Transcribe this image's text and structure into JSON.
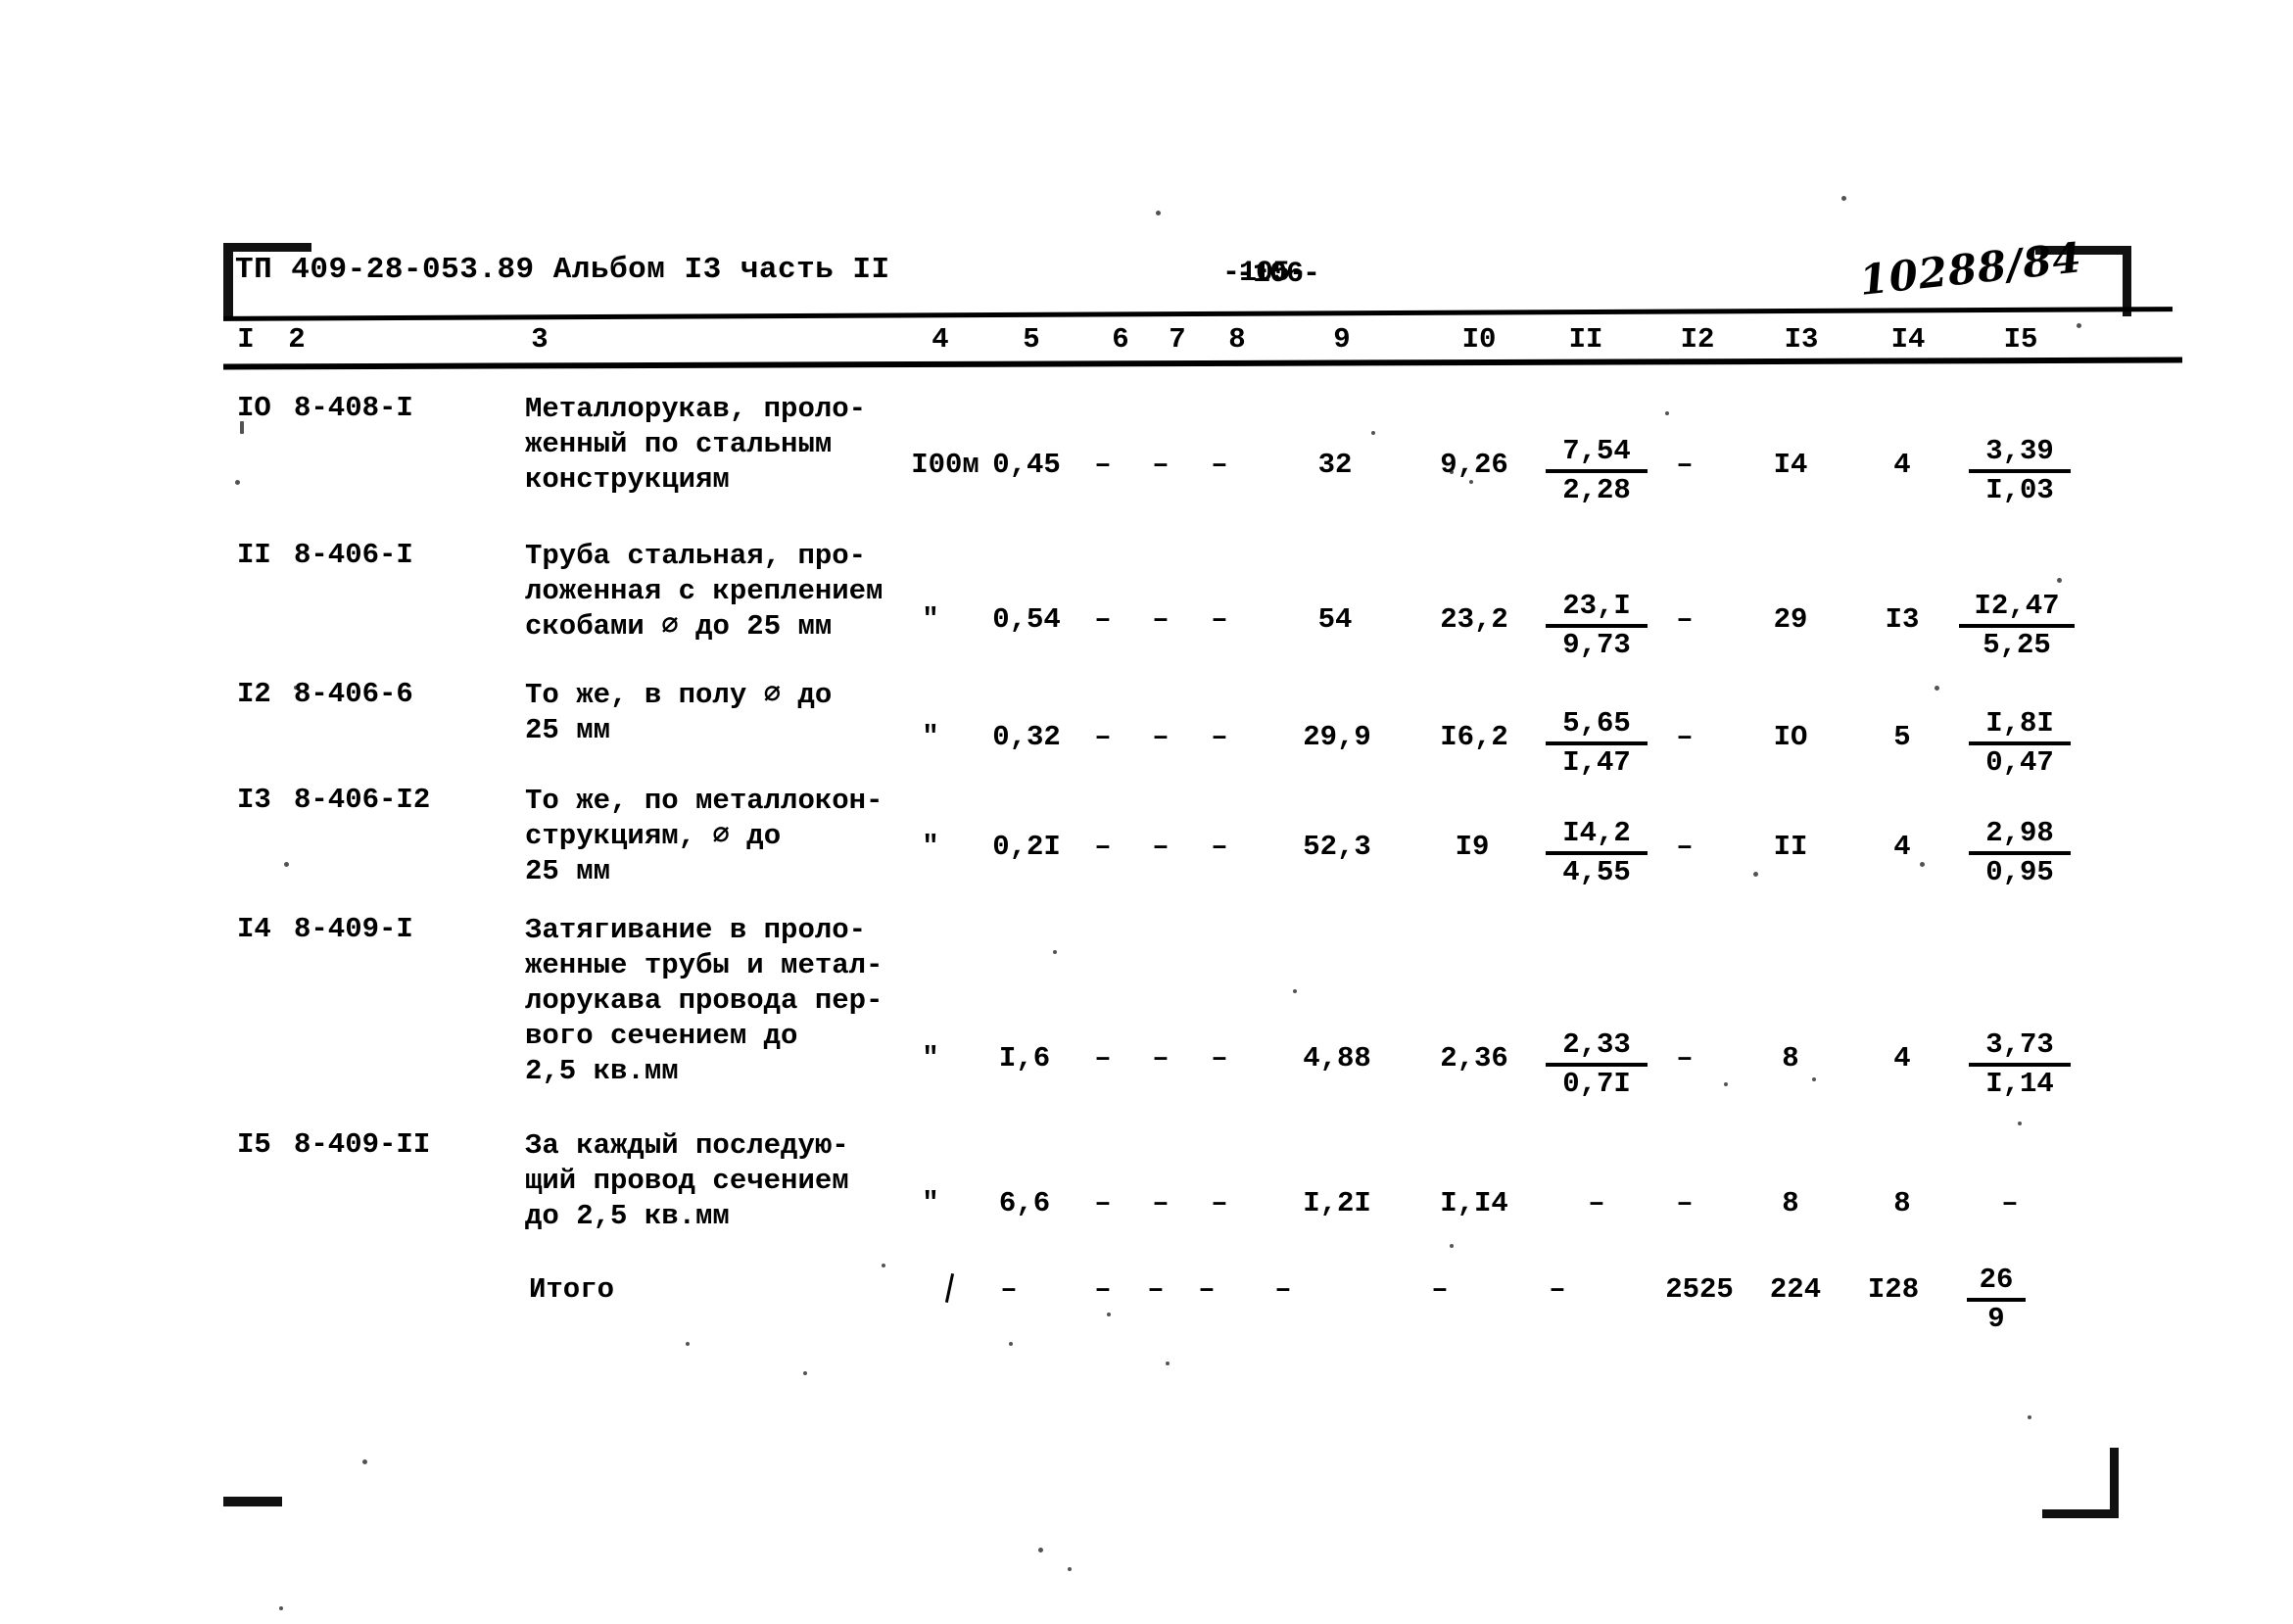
{
  "document": {
    "header": "ТП 409-28-053.89 Альбом I3 часть II",
    "page_number": "-106-",
    "page_number_overstrike": "-105-",
    "handwritten_stamp": "10288/84"
  },
  "table": {
    "column_headers": [
      "I",
      "2",
      "3",
      "4",
      "5",
      "6",
      "7",
      "8",
      "9",
      "I0",
      "II",
      "I2",
      "I3",
      "I4",
      "I5"
    ],
    "rows": [
      {
        "c1": "IO",
        "c2": "8-408-I",
        "c3": "Металлорукав, проло-\nженный по стальным\nконструкциям",
        "c4": "I00м",
        "c5": "0,45",
        "c6": "–",
        "c7": "–",
        "c8": "–",
        "c9": "32",
        "c10": "9,26",
        "c11_top": "7,54",
        "c11_bot": "2,28",
        "c12": "–",
        "c13": "I4",
        "c14": "4",
        "c15_top": "3,39",
        "c15_bot": "I,03"
      },
      {
        "c1": "II",
        "c2": "8-406-I",
        "c3": "Труба стальная, про-\nложенная с креплением\nскобами ⌀ до 25 мм",
        "c4": "\"",
        "c5": "0,54",
        "c6": "–",
        "c7": "–",
        "c8": "–",
        "c9": "54",
        "c10": "23,2",
        "c11_top": "23,I",
        "c11_bot": "9,73",
        "c12": "–",
        "c13": "29",
        "c14": "I3",
        "c15_top": "I2,47",
        "c15_bot": "5,25"
      },
      {
        "c1": "I2",
        "c2": "8-406-6",
        "c3": "То же, в полу ⌀ до\n25 мм",
        "c4": "\"",
        "c5": "0,32",
        "c6": "–",
        "c7": "–",
        "c8": "–",
        "c9": "29,9",
        "c10": "I6,2",
        "c11_top": "5,65",
        "c11_bot": "I,47",
        "c12": "–",
        "c13": "IO",
        "c14": "5",
        "c15_top": "I,8I",
        "c15_bot": "0,47"
      },
      {
        "c1": "I3",
        "c2": "8-406-I2",
        "c3": "То же, по металлокон-\nструкциям, ⌀ до\n25 мм",
        "c4": "\"",
        "c5": "0,2I",
        "c6": "–",
        "c7": "–",
        "c8": "–",
        "c9": "52,3",
        "c10": "I9",
        "c11_top": "I4,2",
        "c11_bot": "4,55",
        "c12": "–",
        "c13": "II",
        "c14": "4",
        "c15_top": "2,98",
        "c15_bot": "0,95"
      },
      {
        "c1": "I4",
        "c2": "8-409-I",
        "c3": "Затягивание в проло-\nженные трубы и метал-\nлорукава провода пер-\nвого сечением до\n2,5 кв.мм",
        "c4": "\"",
        "c5": "I,6",
        "c6": "–",
        "c7": "–",
        "c8": "–",
        "c9": "4,88",
        "c10": "2,36",
        "c11_top": "2,33",
        "c11_bot": "0,7I",
        "c12": "–",
        "c13": "8",
        "c14": "4",
        "c15_top": "3,73",
        "c15_bot": "I,14"
      },
      {
        "c1": "I5",
        "c2": "8-409-II",
        "c3": "За каждый последую-\nщий провод сечением\nдо 2,5 кв.мм",
        "c4": "\"",
        "c5": "6,6",
        "c6": "–",
        "c7": "–",
        "c8": "–",
        "c9": "I,2I",
        "c10": "I,I4",
        "c11_top": "–",
        "c11_bot": "",
        "c12": "–",
        "c13": "8",
        "c14": "8",
        "c15_top": "–",
        "c15_bot": ""
      }
    ],
    "total_row": {
      "label": "Итого",
      "c5": "–",
      "c6": "–",
      "c7": "–",
      "c8": "–",
      "c9": "–",
      "c10": "–",
      "c11": "–",
      "c12": "2525",
      "c13": "224",
      "c14": "I28",
      "c15_top": "26",
      "c15_bot": "9"
    }
  }
}
